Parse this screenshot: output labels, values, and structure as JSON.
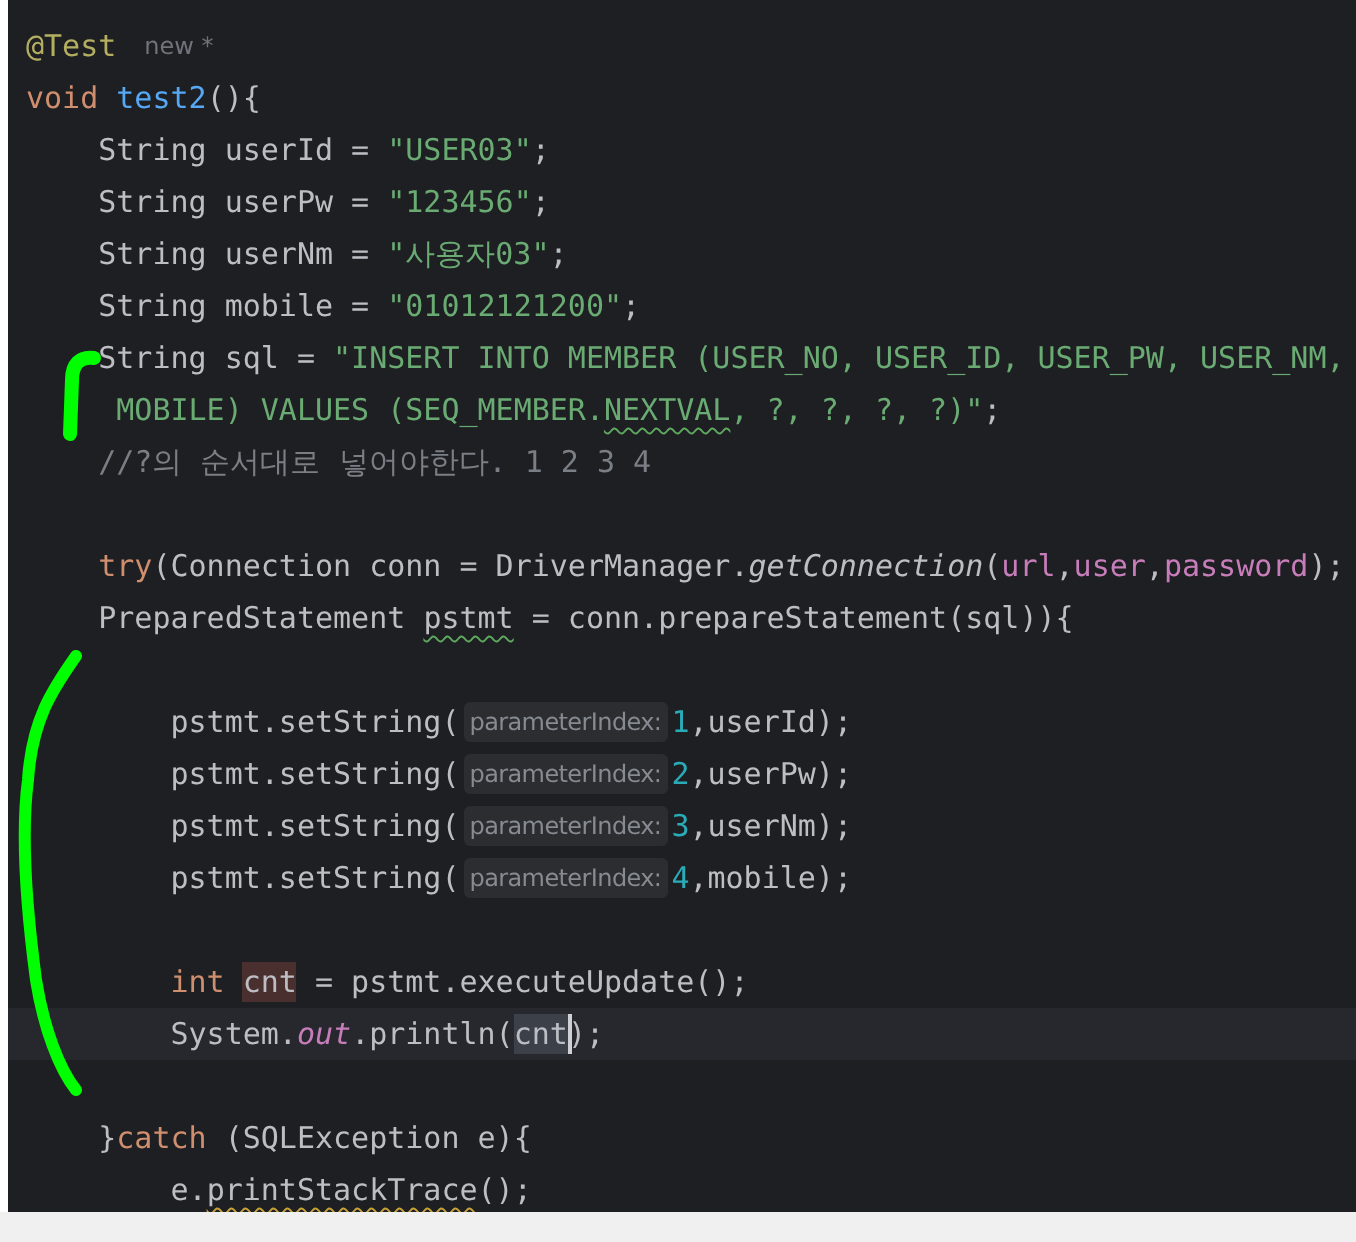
{
  "editor": {
    "lines": [
      {
        "kind": "code",
        "tokens": [
          {
            "text": "@Test",
            "kind": "annotation"
          },
          {
            "text": "new *",
            "kind": "author_hint"
          }
        ]
      },
      {
        "kind": "code",
        "tokens": [
          {
            "text": "void ",
            "kind": "keyword"
          },
          {
            "text": "test2",
            "kind": "declaration"
          },
          {
            "text": "(){",
            "kind": "plain"
          }
        ]
      },
      {
        "kind": "code",
        "tokens": [
          {
            "text": "    String userId = ",
            "kind": "plain"
          },
          {
            "text": "\"USER03\"",
            "kind": "string"
          },
          {
            "text": ";",
            "kind": "plain"
          }
        ]
      },
      {
        "kind": "code",
        "tokens": [
          {
            "text": "    String userPw = ",
            "kind": "plain"
          },
          {
            "text": "\"123456\"",
            "kind": "string"
          },
          {
            "text": ";",
            "kind": "plain"
          }
        ]
      },
      {
        "kind": "code",
        "tokens": [
          {
            "text": "    String userNm = ",
            "kind": "plain"
          },
          {
            "text": "\"사용자03\"",
            "kind": "string"
          },
          {
            "text": ";",
            "kind": "plain"
          }
        ]
      },
      {
        "kind": "code",
        "tokens": [
          {
            "text": "    String mobile = ",
            "kind": "plain"
          },
          {
            "text": "\"01012121200\"",
            "kind": "string"
          },
          {
            "text": ";",
            "kind": "plain"
          }
        ]
      },
      {
        "kind": "code",
        "tokens": [
          {
            "text": "    String sql = ",
            "kind": "plain"
          },
          {
            "text": "\"INSERT INTO MEMBER (USER_NO, USER_ID, USER_PW, USER_NM,",
            "kind": "string"
          }
        ]
      },
      {
        "kind": "code",
        "tokens": [
          {
            "text": "     MOBILE) VALUES (SEQ_MEMBER.",
            "kind": "string"
          },
          {
            "text": "NEXTVAL",
            "kind": "string",
            "misspelled": true
          },
          {
            "text": ", ?, ?, ?, ?)\"",
            "kind": "string"
          },
          {
            "text": ";",
            "kind": "plain"
          }
        ]
      },
      {
        "kind": "code",
        "tokens": [
          {
            "text": "    //?의 순서대로 넣어야한다. 1 2 3 4",
            "kind": "comment"
          }
        ]
      },
      {
        "kind": "blank"
      },
      {
        "kind": "code",
        "tokens": [
          {
            "text": "    try",
            "kind": "keyword"
          },
          {
            "text": "(Connection conn = DriverManager.",
            "kind": "plain"
          },
          {
            "text": "getConnection",
            "kind": "static_method"
          },
          {
            "text": "(",
            "kind": "plain"
          },
          {
            "text": "url",
            "kind": "field"
          },
          {
            "text": ",",
            "kind": "plain"
          },
          {
            "text": "user",
            "kind": "field"
          },
          {
            "text": ",",
            "kind": "plain"
          },
          {
            "text": "password",
            "kind": "field"
          },
          {
            "text": ");",
            "kind": "plain"
          }
        ]
      },
      {
        "kind": "code",
        "tokens": [
          {
            "text": "    PreparedStatement ",
            "kind": "plain"
          },
          {
            "text": "pstmt",
            "kind": "plain",
            "misspelled": true
          },
          {
            "text": " = conn.prepareStatement(sql)){",
            "kind": "plain"
          }
        ]
      },
      {
        "kind": "blank"
      },
      {
        "kind": "code",
        "tokens": [
          {
            "text": "        pstmt.setString(",
            "kind": "plain"
          },
          {
            "text": "parameterIndex:",
            "kind": "hint"
          },
          {
            "text": "1",
            "kind": "number"
          },
          {
            "text": ",userId);",
            "kind": "plain"
          }
        ]
      },
      {
        "kind": "code",
        "tokens": [
          {
            "text": "        pstmt.setString(",
            "kind": "plain"
          },
          {
            "text": "parameterIndex:",
            "kind": "hint"
          },
          {
            "text": "2",
            "kind": "number"
          },
          {
            "text": ",userPw);",
            "kind": "plain"
          }
        ]
      },
      {
        "kind": "code",
        "tokens": [
          {
            "text": "        pstmt.setString(",
            "kind": "plain"
          },
          {
            "text": "parameterIndex:",
            "kind": "hint"
          },
          {
            "text": "3",
            "kind": "number"
          },
          {
            "text": ",userNm);",
            "kind": "plain"
          }
        ]
      },
      {
        "kind": "code",
        "tokens": [
          {
            "text": "        pstmt.setString(",
            "kind": "plain"
          },
          {
            "text": "parameterIndex:",
            "kind": "hint"
          },
          {
            "text": "4",
            "kind": "number"
          },
          {
            "text": ",mobile);",
            "kind": "plain"
          }
        ]
      },
      {
        "kind": "blank"
      },
      {
        "kind": "code",
        "tokens": [
          {
            "text": "        int ",
            "kind": "keyword"
          },
          {
            "text": "cnt",
            "kind": "plain",
            "highlighted": true,
            "written": true
          },
          {
            "text": " = pstmt.executeUpdate();",
            "kind": "plain"
          }
        ]
      },
      {
        "kind": "code",
        "current": true,
        "tokens": [
          {
            "text": "        System.",
            "kind": "plain"
          },
          {
            "text": "out",
            "kind": "static_field"
          },
          {
            "text": ".println(",
            "kind": "plain"
          },
          {
            "text": "cnt",
            "kind": "plain",
            "highlighted": true,
            "written": false,
            "caret": true
          },
          {
            "text": ");",
            "kind": "plain"
          }
        ]
      },
      {
        "kind": "blank"
      },
      {
        "kind": "code",
        "tokens": [
          {
            "text": "    }",
            "kind": "plain"
          },
          {
            "text": "catch",
            "kind": "keyword"
          },
          {
            "text": " (SQLException e){",
            "kind": "plain"
          }
        ]
      },
      {
        "kind": "code",
        "tokens": [
          {
            "text": "        e.",
            "kind": "plain"
          },
          {
            "text": "printStackTrace",
            "kind": "plain",
            "warning": true
          },
          {
            "text": "();",
            "kind": "plain"
          }
        ]
      }
    ]
  }
}
